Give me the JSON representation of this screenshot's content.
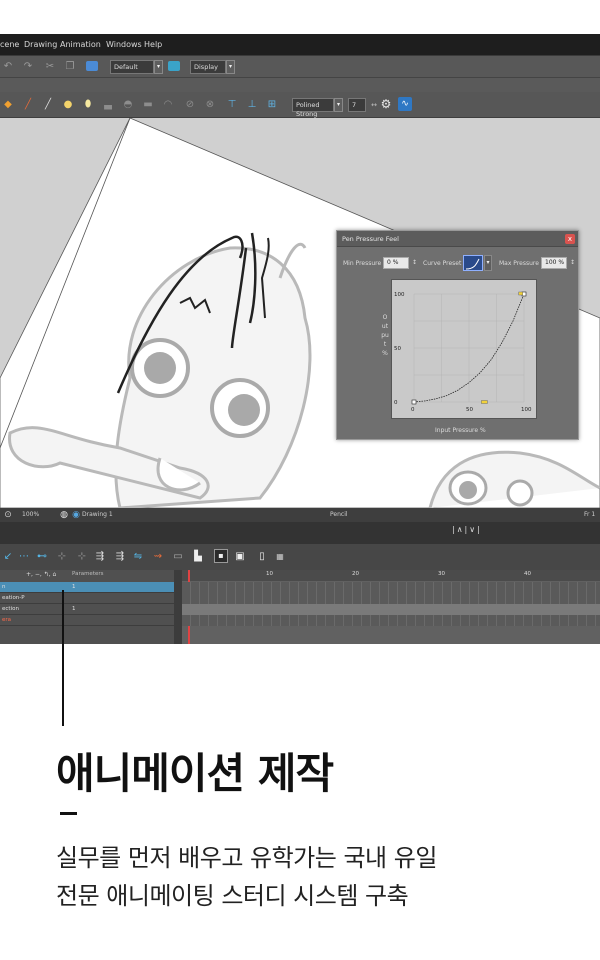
{
  "app": {
    "menu": [
      "cene",
      "Drawing",
      "Animation",
      "Windows",
      "Help"
    ],
    "toolbar1": {
      "preset_value": "Default",
      "display_value": "Display"
    },
    "toolbar2": {
      "brush_value": "Polined Strong",
      "size_value": "7"
    }
  },
  "dialog": {
    "title": "Pen Pressure Feel",
    "min_label": "Min Pressure",
    "min_value": "0 %",
    "curve_label": "Curve Preset",
    "max_label": "Max Pressure",
    "max_value": "100 %",
    "y_axis_label": "Output %",
    "x_axis_label": "Input Pressure %",
    "y_ticks": [
      "100",
      "50",
      "0"
    ],
    "x_ticks": [
      "0",
      "50",
      "100"
    ],
    "close_glyph": "x"
  },
  "chart_data": {
    "type": "line",
    "title": "Pen Pressure Feel",
    "xlabel": "Input Pressure %",
    "ylabel": "Output %",
    "xlim": [
      0,
      100
    ],
    "ylim": [
      0,
      100
    ],
    "x": [
      0,
      10,
      20,
      30,
      40,
      50,
      60,
      70,
      80,
      90,
      100
    ],
    "series": [
      {
        "values": [
          0,
          1,
          3,
          6,
          11,
          18,
          27,
          39,
          55,
          75,
          100
        ]
      }
    ],
    "grid": true
  },
  "timeline": {
    "zoom": "100%",
    "drawing_name": "Drawing 1",
    "view_name": "Pencil",
    "frame_label": "Fr 1",
    "parameters_label": "Parameters",
    "frame_numbers": [
      "10",
      "20",
      "30",
      "40"
    ],
    "layers": [
      {
        "name": "n",
        "value": "1"
      },
      {
        "name": "eation-P",
        "value": ""
      },
      {
        "name": "ection",
        "value": "1"
      },
      {
        "name": "era",
        "value": ""
      }
    ]
  },
  "caption": {
    "title": "애니메이션 제작",
    "line1": "실무를 먼저 배우고 유학가는 국내 유일",
    "line2": "전문 애니메이팅 스터디 시스템 구축"
  }
}
